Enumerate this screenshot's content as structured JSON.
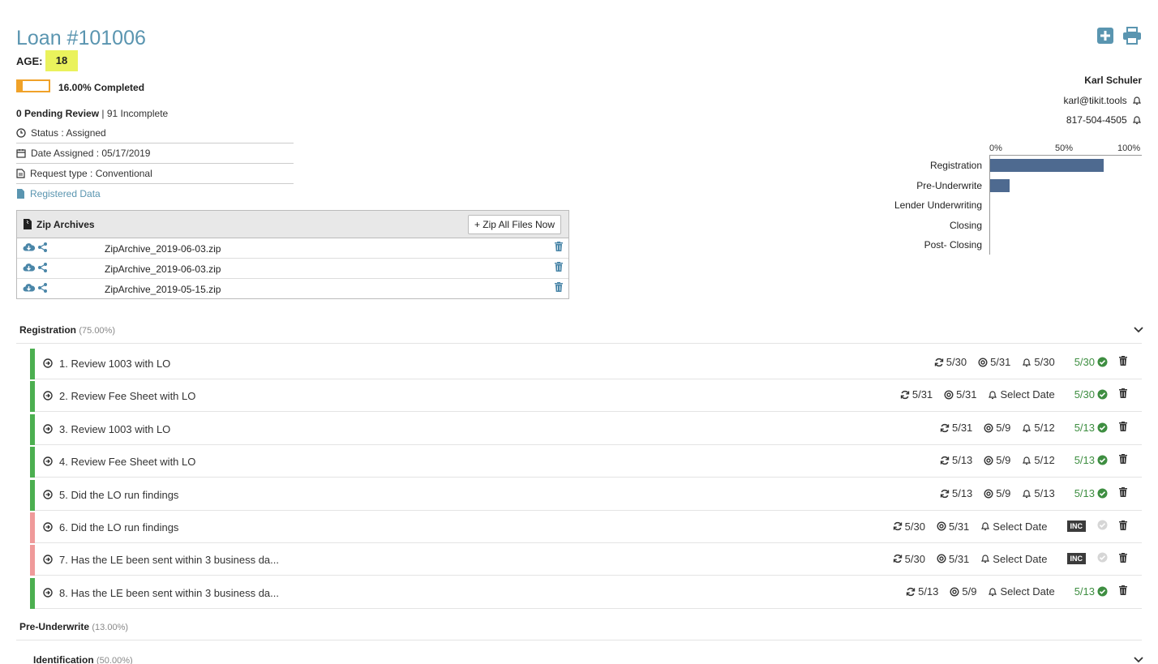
{
  "loan": {
    "title": "Loan #101006",
    "age_label": "AGE:",
    "age_value": "18",
    "progress_percent": 16,
    "progress_text": "16.00% Completed",
    "pending_bold": "0 Pending Review",
    "pending_rest": " | 91 Incomplete",
    "status": "Status : Assigned",
    "date_assigned": "Date Assigned : 05/17/2019",
    "request_type": "Request type : Conventional",
    "registered_data_link": "Registered Data"
  },
  "contact": {
    "name": "Karl Schuler",
    "email": "karl@tikit.tools",
    "phone": "817-504-4505"
  },
  "toolbar_icons": [
    "plus-square-icon",
    "print-icon"
  ],
  "chart_data": {
    "type": "bar",
    "orientation": "horizontal",
    "categories": [
      "Registration",
      "Pre-Underwrite",
      "Lender Underwriting",
      "Closing",
      "Post- Closing"
    ],
    "values": [
      75,
      13,
      0,
      0,
      0
    ],
    "xticks": [
      "0%",
      "50%",
      "100%"
    ],
    "xlim": [
      0,
      100
    ],
    "color": "#4e6a90"
  },
  "zip": {
    "title": "Zip Archives",
    "button": "+ Zip All Files Now",
    "files": [
      "ZipArchive_2019-06-03.zip",
      "ZipArchive_2019-06-03.zip",
      "ZipArchive_2019-05-15.zip"
    ]
  },
  "sections": [
    {
      "name": "Registration",
      "pct": "(75.00%)"
    },
    {
      "name": "Pre-Underwrite",
      "pct": "(13.00%)"
    },
    {
      "name": "Identification",
      "pct": "(50.00%)"
    }
  ],
  "tasks": [
    {
      "label": "1.  Review 1003 with LO",
      "status": "complete",
      "refresh": "5/30",
      "target": "5/31",
      "bell": "5/30",
      "done": "5/30"
    },
    {
      "label": "2.  Review Fee Sheet with LO",
      "status": "complete",
      "refresh": "5/31",
      "target": "5/31",
      "bell": "Select Date",
      "done": "5/30"
    },
    {
      "label": "3.  Review 1003 with LO",
      "status": "complete",
      "refresh": "5/31",
      "target": "5/9",
      "bell": "5/12",
      "done": "5/13"
    },
    {
      "label": "4.  Review Fee Sheet with LO",
      "status": "complete",
      "refresh": "5/13",
      "target": "5/9",
      "bell": "5/12",
      "done": "5/13"
    },
    {
      "label": "5.  Did the LO run findings",
      "status": "complete",
      "refresh": "5/13",
      "target": "5/9",
      "bell": "5/13",
      "done": "5/13"
    },
    {
      "label": "6.  Did the LO run findings",
      "status": "incomplete",
      "refresh": "5/30",
      "target": "5/31",
      "bell": "Select Date",
      "done": "INC"
    },
    {
      "label": "7.  Has the LE been sent within 3 business da...",
      "status": "incomplete",
      "refresh": "5/30",
      "target": "5/31",
      "bell": "Select Date",
      "done": "INC"
    },
    {
      "label": "8.  Has the LE been sent within 3 business da...",
      "status": "complete",
      "refresh": "5/13",
      "target": "5/9",
      "bell": "Select Date",
      "done": "5/13"
    }
  ]
}
